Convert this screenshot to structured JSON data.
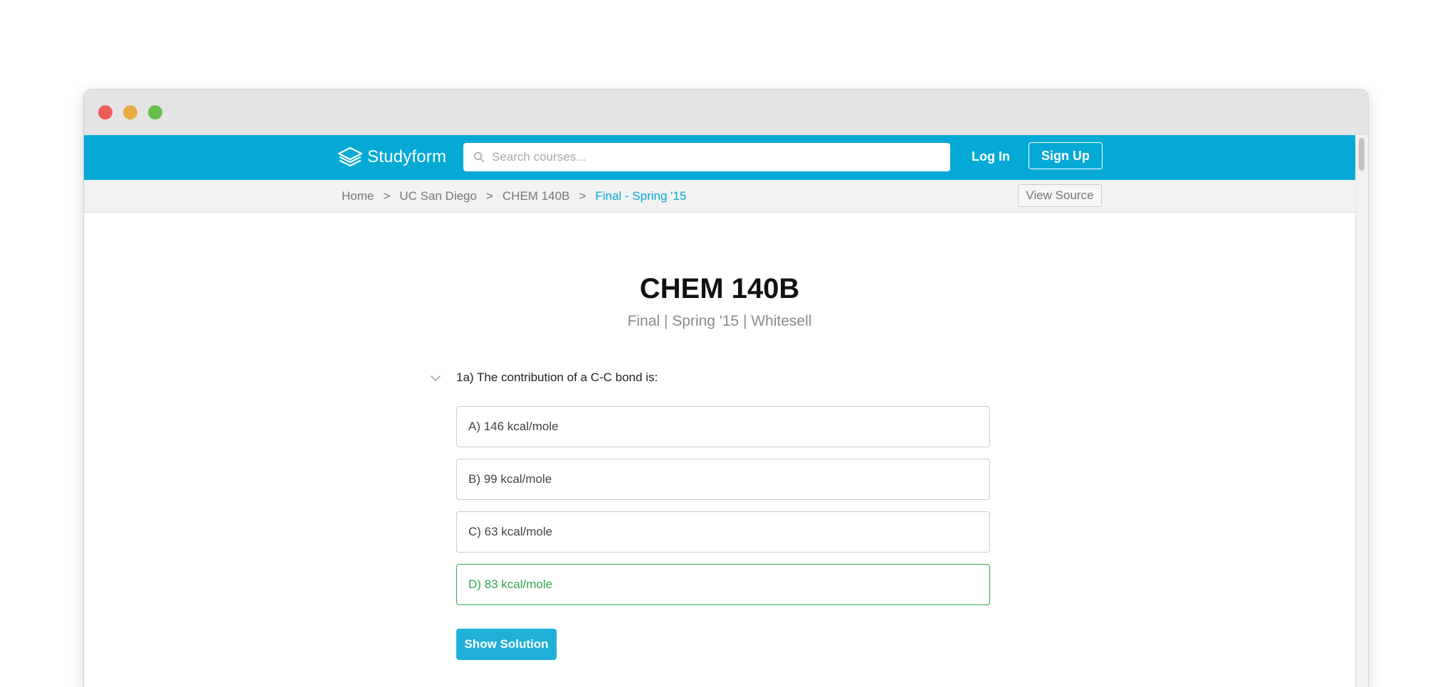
{
  "window": {
    "controls": {
      "close_color": "#ec5e57",
      "minimize_color": "#e6ab42",
      "zoom_color": "#69bd4b"
    }
  },
  "navbar": {
    "background": "#05a9d6",
    "brand": "Studyform",
    "brand_icon": "layers-icon",
    "search": {
      "placeholder": "Search courses...",
      "value": "",
      "icon": "search-icon"
    },
    "login_label": "Log In",
    "signup_label": "Sign Up"
  },
  "breadcrumb": {
    "items": [
      "Home",
      "UC San Diego",
      "CHEM 140B",
      "Final - Spring '15"
    ],
    "separator": ">"
  },
  "view_source_label": "View Source",
  "course": {
    "title": "CHEM 140B",
    "subtitle": "Final | Spring '15 | Whitesell"
  },
  "question": {
    "text": "1a) The contribution of a C-C bond is:",
    "options": [
      {
        "label": "A) 146 kcal/mole",
        "correct": false
      },
      {
        "label": "B) 99 kcal/mole",
        "correct": false
      },
      {
        "label": "C) 63 kcal/mole",
        "correct": false
      },
      {
        "label": "D) 83 kcal/mole",
        "correct": true
      }
    ],
    "correct_color": "#31a850"
  },
  "show_solution_label": "Show Solution"
}
